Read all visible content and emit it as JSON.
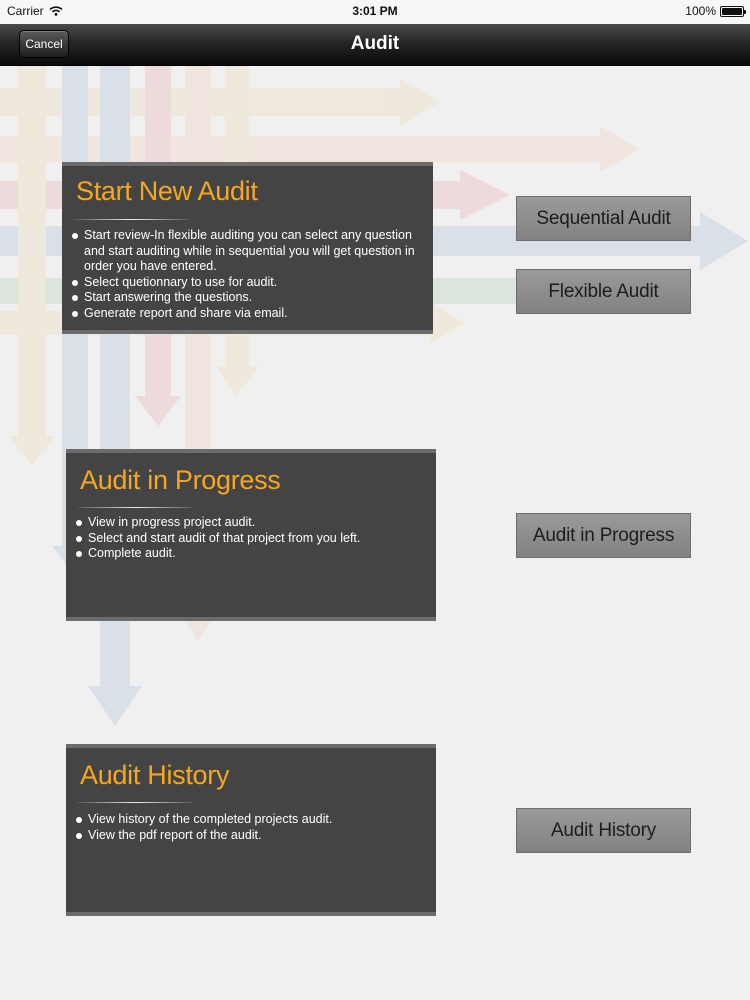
{
  "status_bar": {
    "carrier": "Carrier",
    "time": "3:01 PM",
    "battery": "100%"
  },
  "nav": {
    "title": "Audit",
    "cancel_label": "Cancel"
  },
  "panels": {
    "start_new": {
      "title": "Start New Audit",
      "bullets": [
        "Start review-In flexible auditing you can select any question and start auditing while in sequential you will get question in order you have entered.",
        "Select quetionnary to use for audit.",
        "Start answering the questions.",
        "Generate report and share via email."
      ]
    },
    "in_progress": {
      "title": "Audit in Progress",
      "bullets": [
        "View in progress project audit.",
        "Select and start audit of that project from you left.",
        "Complete audit."
      ]
    },
    "history": {
      "title": "Audit History",
      "bullets": [
        "View history of the completed projects audit.",
        "View the pdf report of the audit."
      ]
    }
  },
  "buttons": {
    "sequential": "Sequential Audit",
    "flexible": "Flexible Audit",
    "in_progress": "Audit in Progress",
    "history": "Audit History"
  },
  "colors": {
    "title_accent": "#f5a81f",
    "panel_bg": "#444444",
    "button_bg": "#8f8f8f"
  }
}
